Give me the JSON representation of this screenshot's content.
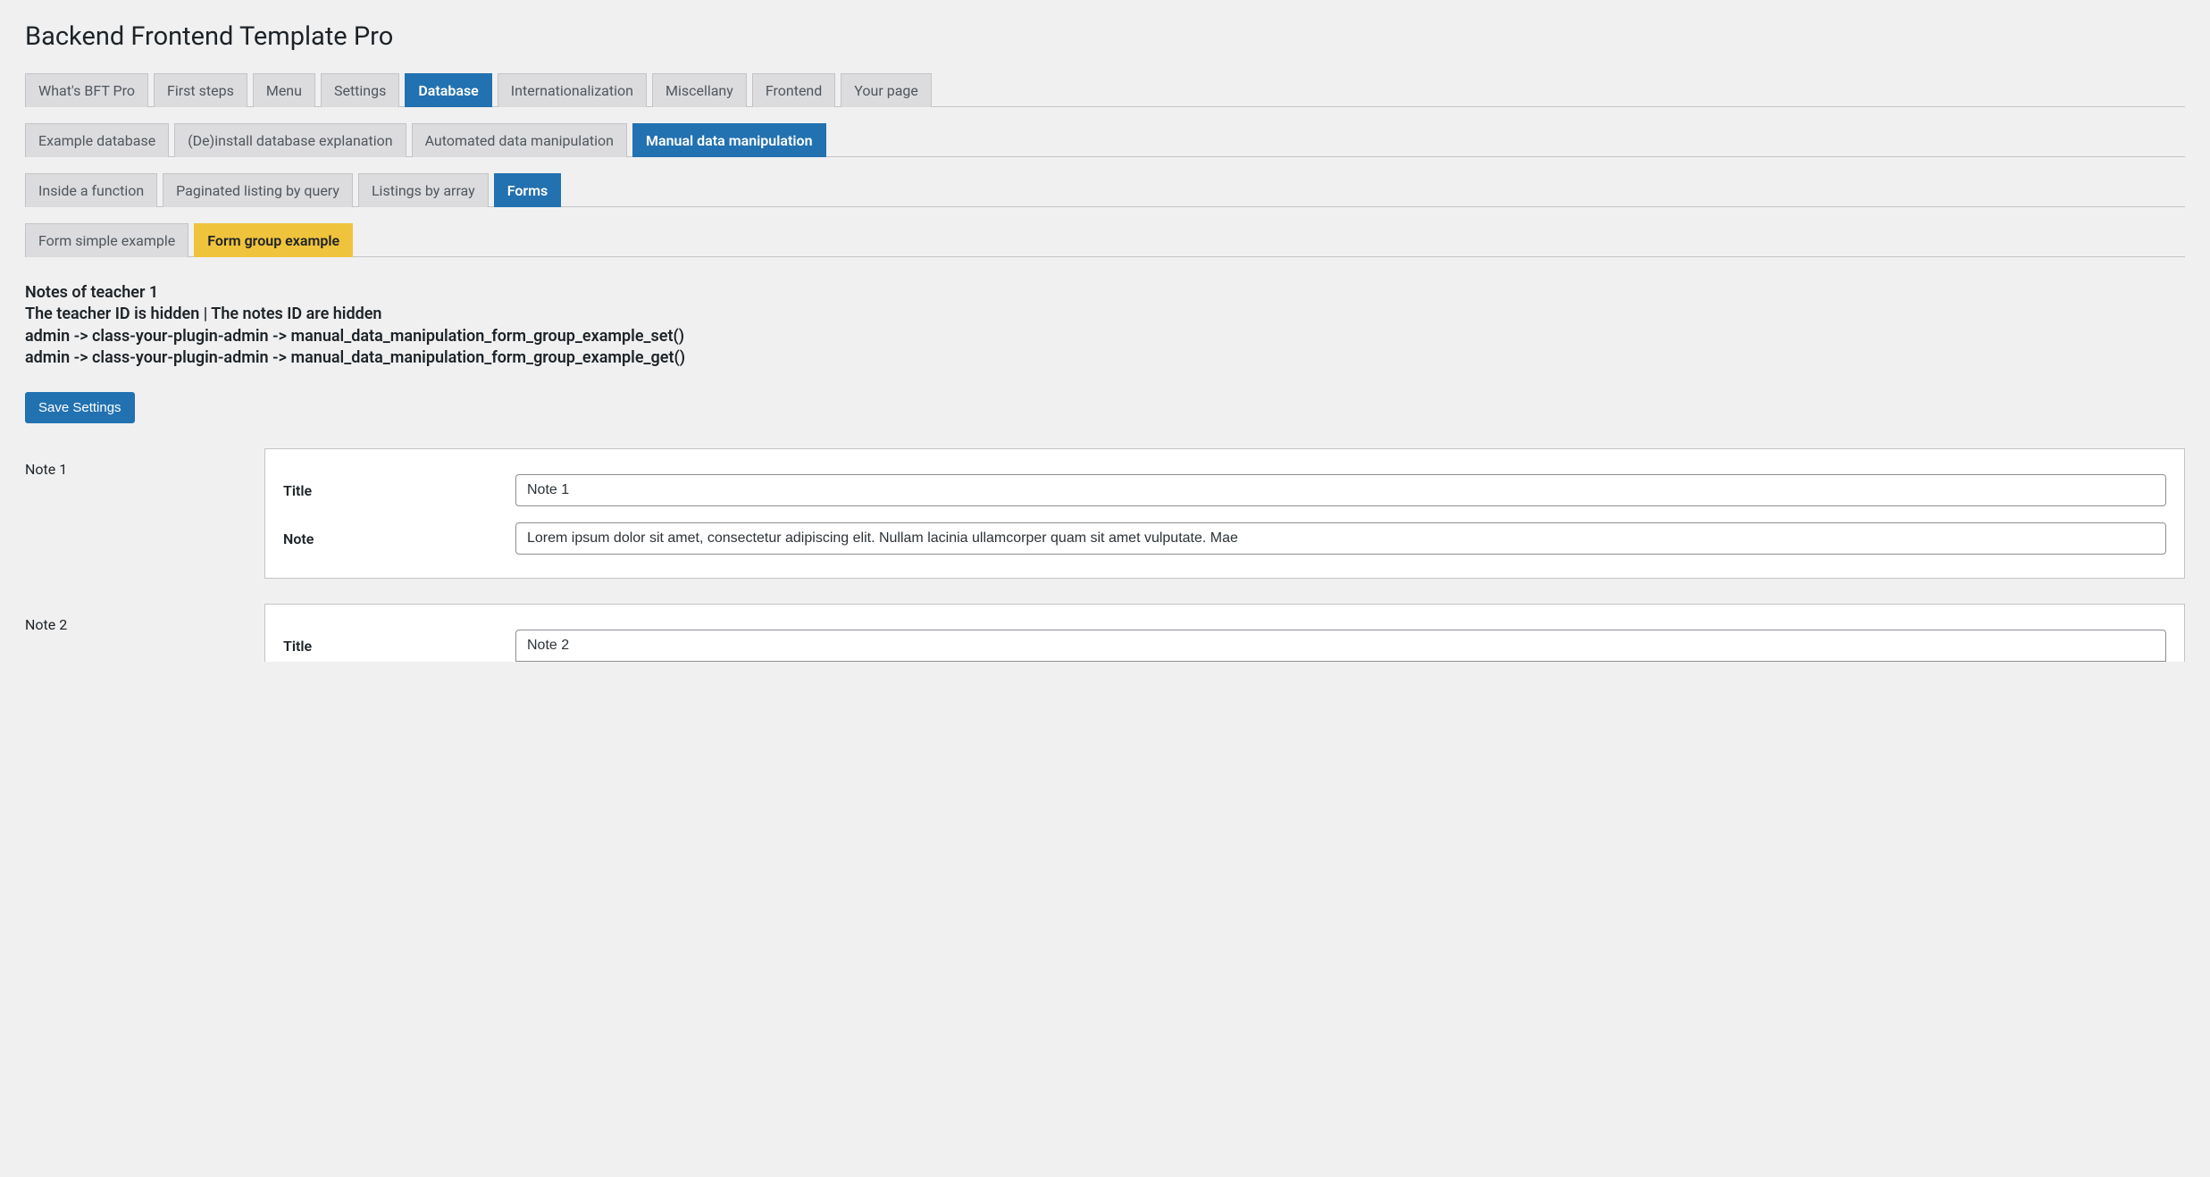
{
  "page_title": "Backend Frontend Template Pro",
  "tab_rows": [
    {
      "tabs": [
        {
          "label": "What's BFT Pro",
          "state": ""
        },
        {
          "label": "First steps",
          "state": ""
        },
        {
          "label": "Menu",
          "state": ""
        },
        {
          "label": "Settings",
          "state": ""
        },
        {
          "label": "Database",
          "state": "active-blue"
        },
        {
          "label": "Internationalization",
          "state": ""
        },
        {
          "label": "Miscellany",
          "state": ""
        },
        {
          "label": "Frontend",
          "state": ""
        },
        {
          "label": "Your page",
          "state": ""
        }
      ]
    },
    {
      "tabs": [
        {
          "label": "Example database",
          "state": ""
        },
        {
          "label": "(De)install database explanation",
          "state": ""
        },
        {
          "label": "Automated data manipulation",
          "state": ""
        },
        {
          "label": "Manual data manipulation",
          "state": "active-blue"
        }
      ]
    },
    {
      "tabs": [
        {
          "label": "Inside a function",
          "state": ""
        },
        {
          "label": "Paginated listing by query",
          "state": ""
        },
        {
          "label": "Listings by array",
          "state": ""
        },
        {
          "label": "Forms",
          "state": "active-blue"
        }
      ]
    },
    {
      "tabs": [
        {
          "label": "Form simple example",
          "state": ""
        },
        {
          "label": "Form group example",
          "state": "active-yellow"
        }
      ]
    }
  ],
  "heading_lines": [
    "Notes of teacher 1",
    "The teacher ID is hidden | The notes ID are hidden",
    "admin -> class-your-plugin-admin -> manual_data_manipulation_form_group_example_set()",
    "admin -> class-your-plugin-admin -> manual_data_manipulation_form_group_example_get()"
  ],
  "save_button_label": "Save Settings",
  "notes": [
    {
      "section_label": "Note 1",
      "fields": [
        {
          "label": "Title",
          "value": "Note 1"
        },
        {
          "label": "Note",
          "value": "Lorem ipsum dolor sit amet, consectetur adipiscing elit. Nullam lacinia ullamcorper quam sit amet vulputate. Mae"
        }
      ]
    },
    {
      "section_label": "Note 2",
      "fields": [
        {
          "label": "Title",
          "value": "Note 2"
        }
      ]
    }
  ]
}
